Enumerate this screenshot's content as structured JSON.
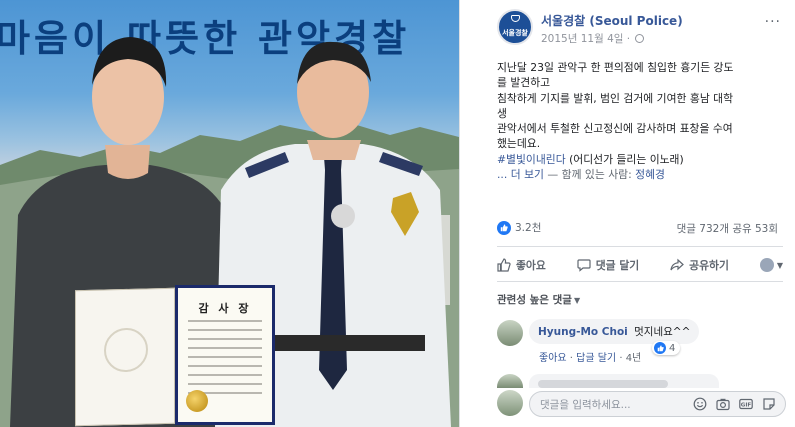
{
  "photo": {
    "banner_text": "마음이 따뜻한 관악경찰",
    "certificate": {
      "title": "감 사 장"
    }
  },
  "post": {
    "avatar_text": "서울경찰",
    "page_name": "서울경찰 (Seoul Police)",
    "timestamp": "2015년 11월 4일 ·",
    "more_icon": "more-dots-icon",
    "body_lines": [
      "지난달 23일 관악구 한 편의점에 침입한 흉기든 강도",
      "를 발견하고",
      "침착하게 기지를 발휘, 범인 검거에 기여한 홍남 대학",
      "생",
      "관악서에서 투철한 신고정신에 감사하며 표창을 수여",
      "했는데요."
    ],
    "hashtag": "#별빛이내린다",
    "hashtag_suffix": " (어디선가 들리는 이노래)",
    "see_more": "... 더 보기",
    "with_prefix": " — 함께 있는 사람: ",
    "tagged_person": "정혜경",
    "reaction_count": "3.2천",
    "comment_share_counts": "댓글 732개 공유 53회",
    "actions": {
      "like": "좋아요",
      "comment": "댓글 달기",
      "share": "공유하기"
    },
    "relevance_label": "관련성 높은 댓글",
    "comments": [
      {
        "author": "Hyung-Mo Choi",
        "text": "멋지네요^^",
        "like_action": "좋아요",
        "reply_action": "답글 달기",
        "age": "4년",
        "reaction_count": "4"
      }
    ],
    "composer_placeholder": "댓글을 입력하세요...",
    "colors": {
      "link": "#385898",
      "like_blue": "#2078f4",
      "avatar_blue": "#1d4f97"
    }
  }
}
